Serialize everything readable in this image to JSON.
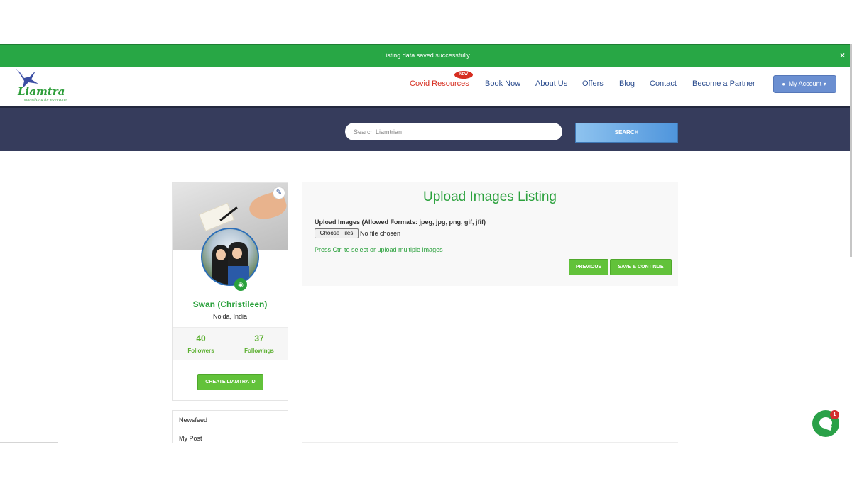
{
  "notification": {
    "message": "Listing data saved successfully",
    "close_glyph": "×"
  },
  "brand": {
    "name": "Liamtra",
    "tagline": "something for everyone"
  },
  "nav": {
    "new_badge": "NEW",
    "items": [
      "Covid Resources",
      "Book Now",
      "About Us",
      "Offers",
      "Blog",
      "Contact",
      "Become a Partner"
    ],
    "account_label": "My Account"
  },
  "search": {
    "placeholder": "Search Liamtrian",
    "button_label": "SEARCH"
  },
  "profile": {
    "name": "Swan (Christileen)",
    "location": "Noida, India",
    "followers_count": "40",
    "followers_label": "Followers",
    "following_count": "37",
    "following_label": "Followings",
    "create_button": "CREATE LIAMTRA ID"
  },
  "side_menu": {
    "items": [
      "Newsfeed",
      "My Post"
    ]
  },
  "upload": {
    "title": "Upload Images Listing",
    "label": "Upload Images (Allowed Formats: jpeg, jpg, png, gif, jfif)",
    "file_button": "Choose Files",
    "file_status": "No file chosen",
    "hint": "Press Ctrl to select or upload multiple images",
    "prev_button": "PREVIOUS",
    "save_button": "SAVE & CONTINUE"
  },
  "chat": {
    "badge_count": "1"
  },
  "colors": {
    "primary_green": "#2ba13d",
    "nav_blue": "#2b4c8e",
    "band": "#363c5c",
    "covid_red": "#d62d1f"
  }
}
